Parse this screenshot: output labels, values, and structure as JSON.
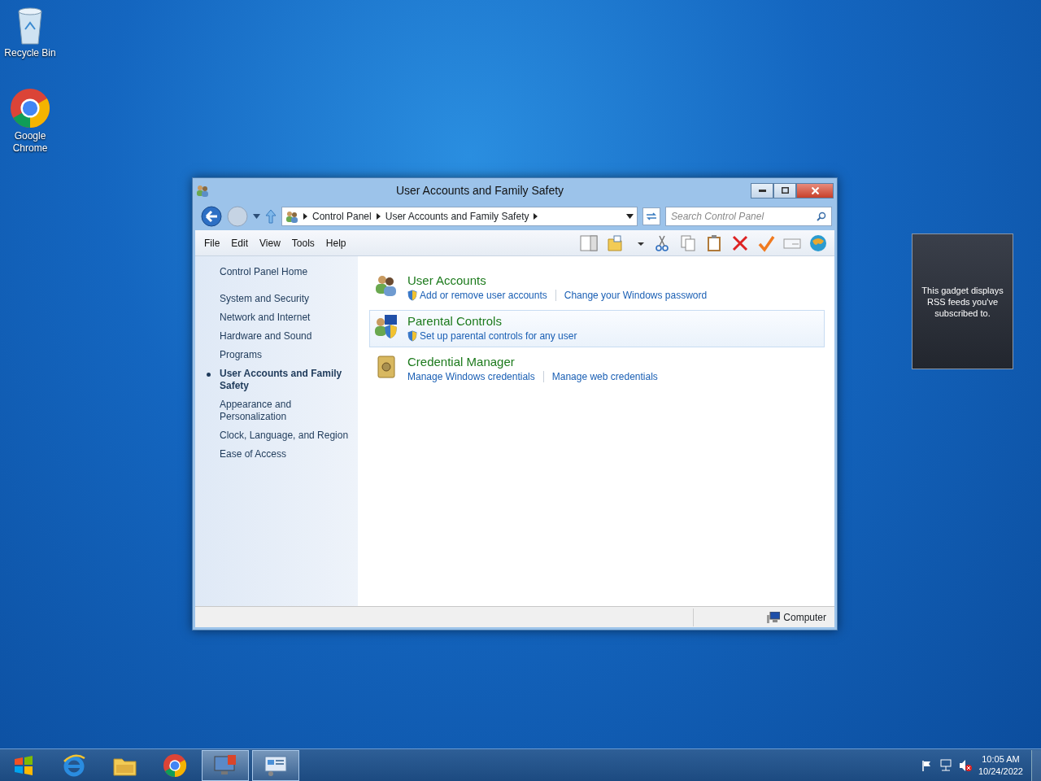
{
  "desktop_icons": [
    {
      "kind": "recycle-bin",
      "label": "Recycle Bin"
    },
    {
      "kind": "chrome",
      "label": "Google Chrome"
    }
  ],
  "window": {
    "title": "User Accounts and Family Safety",
    "breadcrumbs": [
      "Control Panel",
      "User Accounts and Family Safety"
    ],
    "search": {
      "placeholder": "Search Control Panel"
    },
    "menu": [
      "File",
      "Edit",
      "View",
      "Tools",
      "Help"
    ],
    "sidebar": {
      "home": "Control Panel Home",
      "items": [
        {
          "label": "System and Security",
          "selected": false
        },
        {
          "label": "Network and Internet",
          "selected": false
        },
        {
          "label": "Hardware and Sound",
          "selected": false
        },
        {
          "label": "Programs",
          "selected": false
        },
        {
          "label": "User Accounts and Family Safety",
          "selected": true
        },
        {
          "label": "Appearance and Personalization",
          "selected": false
        },
        {
          "label": "Clock, Language, and Region",
          "selected": false
        },
        {
          "label": "Ease of Access",
          "selected": false
        }
      ]
    },
    "categories": [
      {
        "kind": "users",
        "title": "User Accounts",
        "highlighted": false,
        "links": [
          {
            "text": "Add or remove user accounts",
            "shield": true
          },
          {
            "text": "Change your Windows password",
            "shield": false
          }
        ]
      },
      {
        "kind": "parental",
        "title": "Parental Controls",
        "highlighted": true,
        "links": [
          {
            "text": "Set up parental controls for any user",
            "shield": true
          }
        ]
      },
      {
        "kind": "vault",
        "title": "Credential Manager",
        "highlighted": false,
        "links": [
          {
            "text": "Manage Windows credentials",
            "shield": false
          },
          {
            "text": "Manage web credentials",
            "shield": false
          }
        ]
      }
    ],
    "status_bar": {
      "text": "Computer"
    }
  },
  "gadget": {
    "text": "This gadget displays RSS feeds you've subscribed to."
  },
  "taskbar": {
    "buttons": [
      {
        "kind": "ie",
        "running": false
      },
      {
        "kind": "folder",
        "running": false
      },
      {
        "kind": "chrome",
        "running": false
      },
      {
        "kind": "monitor",
        "running": true
      },
      {
        "kind": "control-panel",
        "running": true
      }
    ],
    "time": "10:05 AM",
    "date": "10/24/2022"
  }
}
